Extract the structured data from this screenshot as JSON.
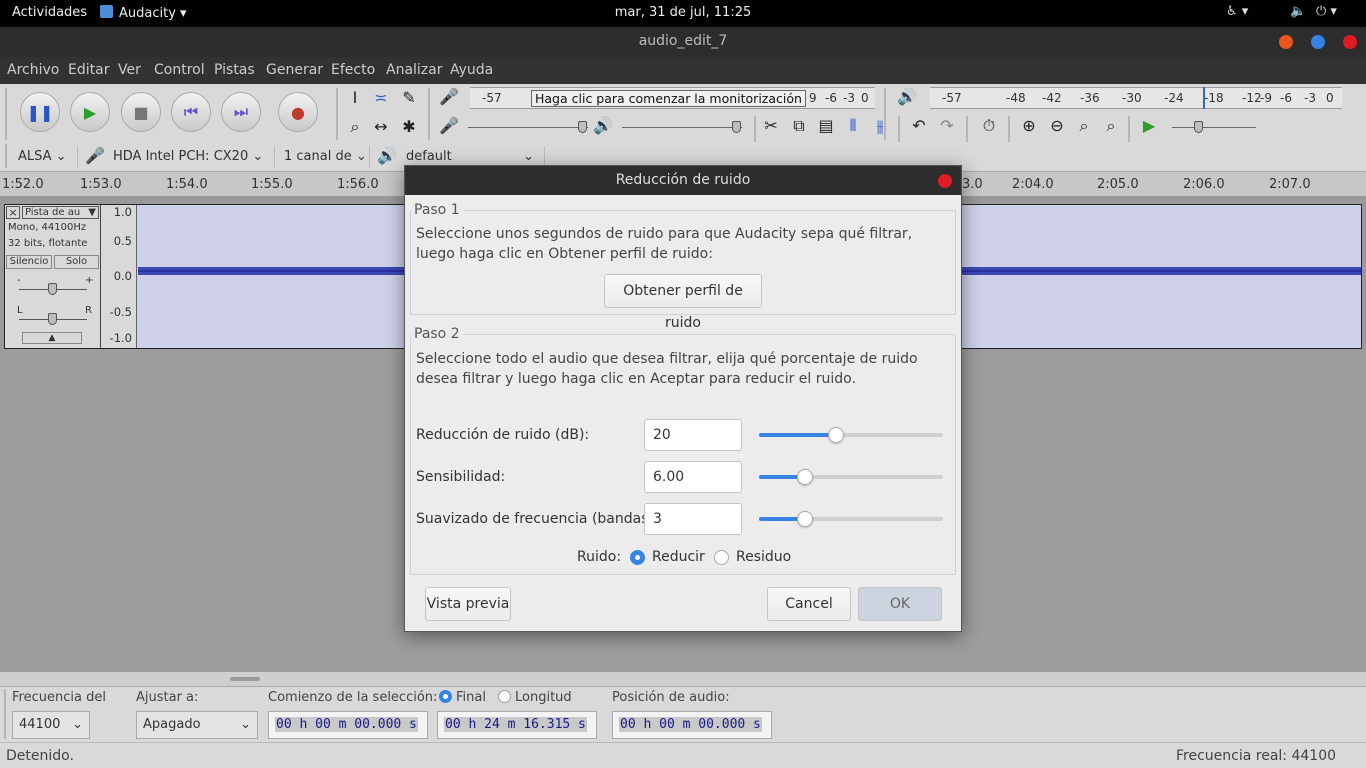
{
  "topbar": {
    "activities": "Actividades",
    "app_name": "Audacity",
    "datetime": "mar, 31 de jul, 11:25"
  },
  "window": {
    "title": "audio_edit_7",
    "colors": {
      "minimize": "#e95420",
      "maximize": "#3584e4",
      "close": "#e01b24"
    }
  },
  "menu": [
    "Archivo",
    "Editar",
    "Ver",
    "Control",
    "Pistas",
    "Generar",
    "Efecto",
    "Analizar",
    "Ayuda"
  ],
  "meters": {
    "record_scale": [
      "-57",
      "9",
      "-6",
      "-3",
      "0"
    ],
    "monitor_prompt": "Haga clic para comenzar la monitorización",
    "play_scale": [
      "-57",
      "-48",
      "-42",
      "-36",
      "-30",
      "-24",
      "-18",
      "-12",
      "-9",
      "-6",
      "-3",
      "0"
    ]
  },
  "device": {
    "host": "ALSA",
    "input": "HDA Intel PCH: CX20",
    "channels": "1 canal de",
    "output": "default"
  },
  "timeline": [
    "1:52.0",
    "1:53.0",
    "1:54.0",
    "1:55.0",
    "1:56.0",
    "3.0",
    "2:04.0",
    "2:05.0",
    "2:06.0",
    "2:07.0"
  ],
  "track": {
    "name": "Pista de au",
    "info1": "Mono, 44100Hz",
    "info2": "32 bits, flotante",
    "mute": "Silencio",
    "solo": "Solo",
    "gain_minus": "-",
    "gain_plus": "+",
    "pan_left": "L",
    "pan_right": "R",
    "ruler": [
      "1.0",
      "0.5",
      "0.0",
      "-0.5",
      "-1.0"
    ],
    "wave_color": "#3b48b8"
  },
  "dialog": {
    "title": "Reducción de ruido",
    "step1": {
      "legend": "Paso 1",
      "text": "Seleccione unos segundos de ruido para que Audacity sepa qué filtrar, luego haga clic en Obtener perfil de ruido:",
      "button": "Obtener perfil de ruido"
    },
    "step2": {
      "legend": "Paso 2",
      "text": "Seleccione todo el audio que desea filtrar, elija qué porcentaje de ruido desea filtrar y luego haga clic en Aceptar para reducir el ruido.",
      "params": [
        {
          "label": "Reducción de ruido (dB):",
          "value": "20",
          "level": 0.42
        },
        {
          "label": "Sensibilidad:",
          "value": "6.00",
          "level": 0.25
        },
        {
          "label": "Suavizado de frecuencia (bandas):",
          "value": "3",
          "level": 0.25
        }
      ],
      "noise_label": "Ruido:",
      "noise_options": [
        "Reducir",
        "Residuo"
      ],
      "noise_selected": "Reducir"
    },
    "preview": "Vista previa",
    "cancel": "Cancel",
    "ok": "OK",
    "accent": "#3584e4"
  },
  "selection_toolbar": {
    "rate_label": "Frecuencia del",
    "rate_value": "44100",
    "snap_label": "Ajustar a:",
    "snap_value": "Apagado",
    "start_label": "Comienzo de la selección:",
    "end_option": "Final",
    "length_option": "Longitud",
    "start_time": "00 h 00 m 00.000 s",
    "end_time": "00 h 24 m 16.315 s",
    "position_label": "Posición de audio:",
    "position_time": "00 h 00 m 00.000 s"
  },
  "status": {
    "left": "Detenido.",
    "right": "Frecuencia real: 44100"
  }
}
